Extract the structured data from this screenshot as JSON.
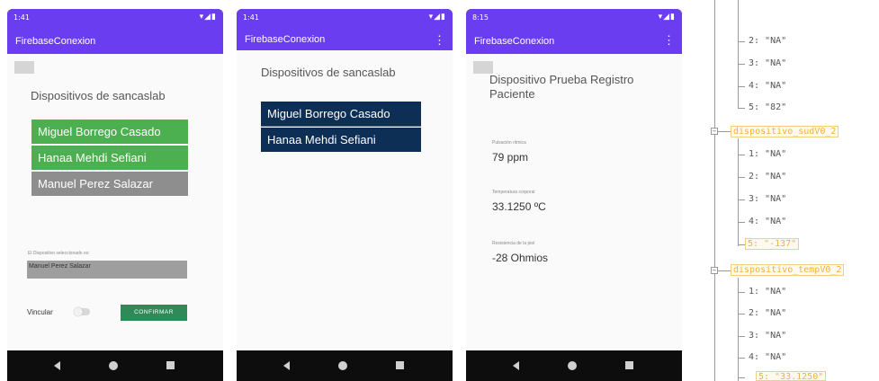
{
  "status_time_1": "1:41",
  "status_time_2": "1:41",
  "status_time_3": "8:15",
  "status_icons": "▾◢▮",
  "app_title": "FirebaseConexion",
  "screen1": {
    "heading": "Dispositivos de sancaslab",
    "devices": [
      "Miguel Borrego Casado",
      "Hanaa Mehdi Sefiani",
      "Manuel Perez Salazar"
    ],
    "selected_label": "El Dispositivo seleccionado es:",
    "selected_value": "Manuel Perez Salazar",
    "vincular_label": "Vincular",
    "confirm_label": "CONFIRMAR"
  },
  "screen2": {
    "heading": "Dispositivos de sancaslab",
    "devices": [
      "Miguel Borrego Casado",
      "Hanaa Mehdi Sefiani"
    ]
  },
  "screen3": {
    "heading": "Dispositivo Prueba Registro Paciente",
    "sensors": [
      {
        "label": "Pulsación ritmica",
        "value": "79 ppm"
      },
      {
        "label": "Temperatura corporal",
        "value": "33.1250 ºC"
      },
      {
        "label": "Resistencia de la piel",
        "value": "-28 Ohmios"
      }
    ]
  },
  "tree": {
    "group1_items": [
      "2: \"NA\"",
      "3: \"NA\"",
      "4: \"NA\"",
      "5: \"82\""
    ],
    "node2": "dispositivo_sudV0_2",
    "group2_items": [
      "1: \"NA\"",
      "2: \"NA\"",
      "3: \"NA\"",
      "4: \"NA\""
    ],
    "group2_last": "5: \"-137\"",
    "node3": "dispositivo_tempV0_2",
    "group3_items": [
      "1: \"NA\"",
      "2: \"NA\"",
      "3: \"NA\"",
      "4: \"NA\""
    ],
    "group3_last": "5: \"33.1250\""
  },
  "colors": {
    "app_bar": "#6a3df0",
    "green_button": "#4caf50",
    "grey_button": "#8e8e8e",
    "navy_button": "#0e2f55",
    "confirm": "#2e8b57",
    "tree_node": "#f2b13a"
  }
}
